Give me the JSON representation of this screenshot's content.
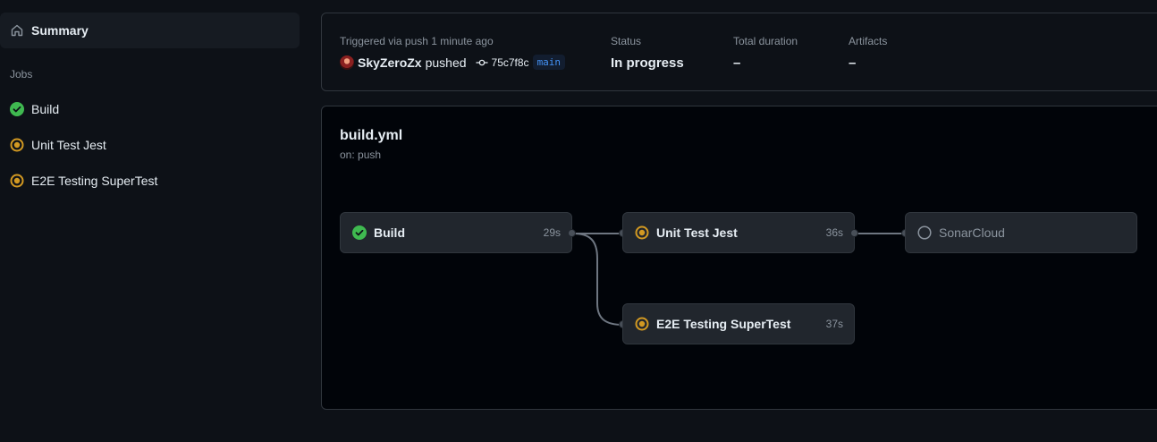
{
  "sidebar": {
    "summary_label": "Summary",
    "jobs_heading": "Jobs",
    "jobs": [
      {
        "label": "Build",
        "status": "success"
      },
      {
        "label": "Unit Test Jest",
        "status": "in_progress"
      },
      {
        "label": "E2E Testing SuperTest",
        "status": "in_progress"
      }
    ]
  },
  "run": {
    "trigger_text": "Triggered via push 1 minute ago",
    "actor": "SkyZeroZx",
    "action": "pushed",
    "commit_sha": "75c7f8c",
    "branch": "main",
    "status_label": "Status",
    "status_value": "In progress",
    "duration_label": "Total duration",
    "duration_value": "–",
    "artifacts_label": "Artifacts",
    "artifacts_value": "–"
  },
  "workflow": {
    "file": "build.yml",
    "trigger": "on: push",
    "nodes": [
      {
        "name": "Build",
        "duration": "29s",
        "status": "success"
      },
      {
        "name": "Unit Test Jest",
        "duration": "36s",
        "status": "in_progress"
      },
      {
        "name": "SonarCloud",
        "duration": "",
        "status": "queued"
      },
      {
        "name": "E2E Testing SuperTest",
        "duration": "37s",
        "status": "in_progress"
      }
    ]
  },
  "colors": {
    "success": "#3fb950",
    "in_progress": "#d29922",
    "queued": "#8b949e",
    "branch_text": "#4493f8"
  }
}
